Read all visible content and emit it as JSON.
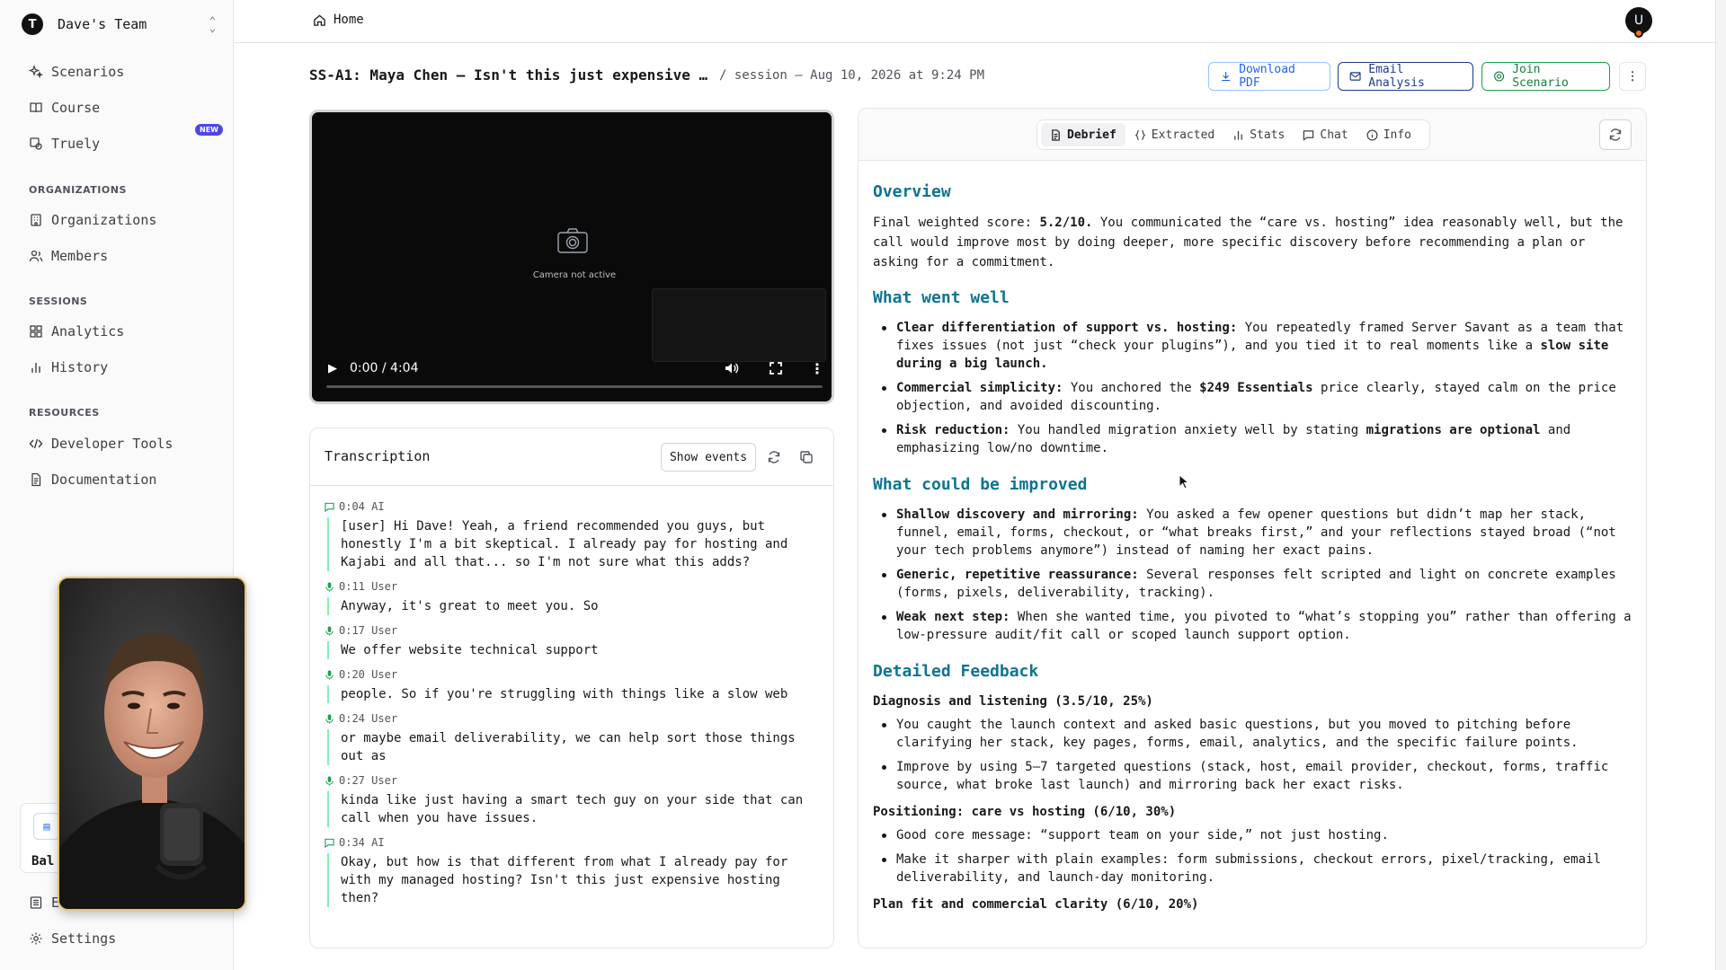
{
  "sidebar": {
    "team_initial": "T",
    "team_name": "Dave's Team",
    "items": [
      {
        "label": "Scenarios",
        "icon": "sparkles-icon"
      },
      {
        "label": "Course",
        "icon": "book-icon"
      },
      {
        "label": "Truely",
        "icon": "truely-icon",
        "badge": "NEW"
      }
    ],
    "sections": {
      "organizations": {
        "title": "ORGANIZATIONS",
        "items": [
          "Organizations",
          "Members"
        ]
      },
      "sessions": {
        "title": "SESSIONS",
        "items": [
          "Analytics",
          "History"
        ]
      },
      "resources": {
        "title": "RESOURCES",
        "items": [
          "Developer Tools",
          "Documentation"
        ]
      }
    },
    "credit_label": "Bal",
    "hidden_item_label": "E",
    "settings": "Settings"
  },
  "topbar": {
    "home": "Home",
    "avatar_initial": "U"
  },
  "header": {
    "title": "SS-A1: Maya Chen — Isn't this just expensive …",
    "subtitle": "/ session — Aug 10, 2026 at 9:24 PM",
    "download_pdf": "Download PDF",
    "email_analysis": "Email Analysis",
    "join_scenario": "Join Scenario"
  },
  "video": {
    "camera_status": "Camera not active",
    "time": "0:00 / 4:04",
    "progress": 0
  },
  "transcription": {
    "title": "Transcription",
    "show_events": "Show events",
    "entries": [
      {
        "time": "0:04",
        "speaker": "AI",
        "text": "[user] Hi Dave! Yeah, a friend recommended you guys, but honestly I'm a bit skeptical. I already pay for hosting and Kajabi and all that... so I'm not sure what this adds?"
      },
      {
        "time": "0:11",
        "speaker": "User",
        "text": "Anyway, it's great to meet you. So"
      },
      {
        "time": "0:17",
        "speaker": "User",
        "text": "We offer website technical support"
      },
      {
        "time": "0:20",
        "speaker": "User",
        "text": "people. So if you're struggling with things like a slow web"
      },
      {
        "time": "0:24",
        "speaker": "User",
        "text": "or maybe email deliverability, we can help sort those things out as"
      },
      {
        "time": "0:27",
        "speaker": "User",
        "text": "kinda like just having a smart tech guy on your side that can call when you have issues."
      },
      {
        "time": "0:34",
        "speaker": "AI",
        "text": "Okay, but how is that different from what I already pay for with my managed hosting? Isn't this just expensive hosting then?"
      }
    ]
  },
  "tabs": [
    "Debrief",
    "Extracted",
    "Stats",
    "Chat",
    "Info"
  ],
  "debrief": {
    "overview_title": "Overview",
    "overview_prefix": "Final weighted score: ",
    "overview_score": "5.2/10.",
    "overview_rest": " You communicated the “care vs. hosting” idea reasonably well, but the call would improve most by doing deeper, more specific discovery before recommending a plan or asking for a commitment.",
    "well_title": "What went well",
    "well": [
      {
        "label": "Clear differentiation of support vs. hosting:",
        "pre": " You repeatedly framed Server Savant as a team that fixes issues (not just “check your plugins”), and you tied it to real moments like a ",
        "bold": "slow site during a big launch.",
        "post": ""
      },
      {
        "label": "Commercial simplicity:",
        "pre": " You anchored the ",
        "bold": "$249 Essentials",
        "post": " price clearly, stayed calm on the price objection, and avoided discounting."
      },
      {
        "label": "Risk reduction:",
        "pre": " You handled migration anxiety well by stating ",
        "bold": "migrations are optional",
        "post": " and emphasizing low/no downtime."
      }
    ],
    "improve_title": "What could be improved",
    "improve": [
      {
        "label": "Shallow discovery and mirroring:",
        "text": " You asked a few opener questions but didn’t map her stack, funnel, email, forms, checkout, or “what breaks first,” and your reflections stayed broad (“not your tech problems anymore”) instead of naming her exact pains."
      },
      {
        "label": "Generic, repetitive reassurance:",
        "text": " Several responses felt scripted and light on concrete examples (forms, pixels, deliverability, tracking)."
      },
      {
        "label": "Weak next step:",
        "text": " When she wanted time, you pivoted to “what’s stopping you” rather than offering a low-pressure audit/fit call or scoped launch support option."
      }
    ],
    "detailed_title": "Detailed Feedback",
    "sections": [
      {
        "title": "Diagnosis and listening (3.5/10, 25%)",
        "items": [
          "You caught the launch context and asked basic questions, but you moved to pitching before clarifying her stack, key pages, forms, email, analytics, and the specific failure points.",
          "Improve by using 5–7 targeted questions (stack, host, email provider, checkout, forms, traffic source, what broke last launch) and mirroring back her exact risks."
        ]
      },
      {
        "title": "Positioning: care vs hosting (6/10, 30%)",
        "items": [
          "Good core message: “support team on your side,” not just hosting.",
          "Make it sharper with plain examples: form submissions, checkout errors, pixel/tracking, email deliverability, and launch-day monitoring."
        ]
      },
      {
        "title": "Plan fit and commercial clarity (6/10, 20%)",
        "items": []
      }
    ]
  }
}
